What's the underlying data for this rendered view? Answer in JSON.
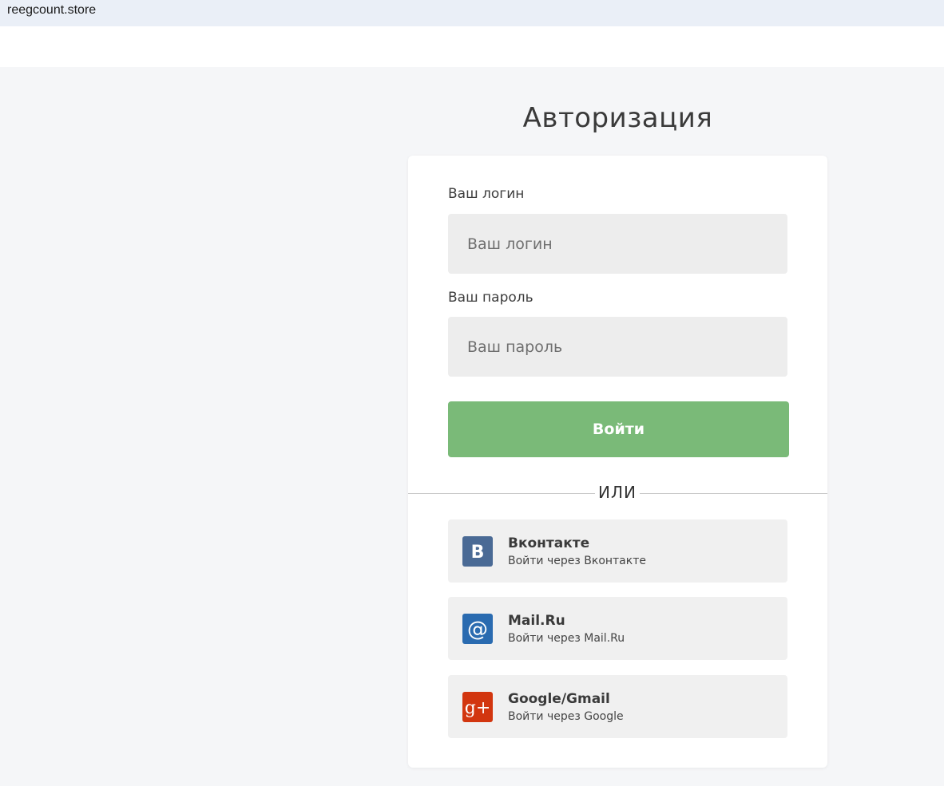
{
  "browser": {
    "url": "reegcount.store"
  },
  "page": {
    "title": "Авторизация"
  },
  "form": {
    "login_label": "Ваш логин",
    "login_placeholder": "Ваш логин",
    "login_value": "",
    "password_label": "Ваш пароль",
    "password_placeholder": "Ваш пароль",
    "password_value": "",
    "submit_label": "Войти",
    "divider_text": "ИЛИ"
  },
  "social": [
    {
      "name": "Вконтакте",
      "subtitle": "Войти через Вконтакте",
      "icon": "vk-icon",
      "icon_text": "B",
      "color": "#4a6a95"
    },
    {
      "name": "Mail.Ru",
      "subtitle": "Войти через Mail.Ru",
      "icon": "mailru-icon",
      "icon_text": "@",
      "color": "#2a6bb0"
    },
    {
      "name": "Google/Gmail",
      "subtitle": "Войти через Google",
      "icon": "google-plus-icon",
      "icon_text": "g+",
      "color": "#d2360f"
    }
  ],
  "colors": {
    "accent_green": "#7aba78",
    "page_bg": "#f5f6f8",
    "url_bar_bg": "#eaeff7",
    "input_bg": "#ededed",
    "social_bg": "#f0f0f0"
  }
}
